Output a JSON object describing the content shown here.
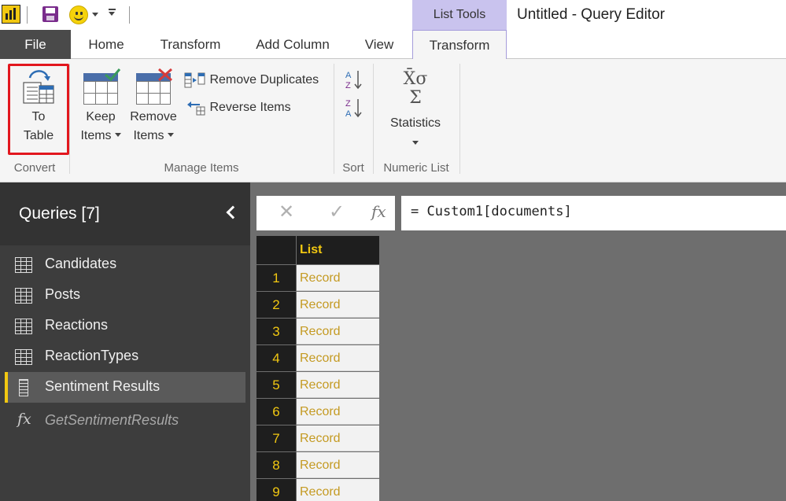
{
  "window": {
    "title": "Untitled - Query Editor",
    "context_tab_group": "List Tools"
  },
  "tabs": [
    {
      "label": "File"
    },
    {
      "label": "Home"
    },
    {
      "label": "Transform"
    },
    {
      "label": "Add Column"
    },
    {
      "label": "View"
    },
    {
      "label": "Transform",
      "active": true
    }
  ],
  "ribbon": {
    "convert": {
      "group_label": "Convert",
      "to_table_line1": "To",
      "to_table_line2": "Table"
    },
    "manage_items": {
      "group_label": "Manage Items",
      "keep_line1": "Keep",
      "keep_line2": "Items",
      "remove_line1": "Remove",
      "remove_line2": "Items",
      "remove_duplicates": "Remove Duplicates",
      "reverse_items": "Reverse Items"
    },
    "sort": {
      "group_label": "Sort",
      "ascending_icon": "sort-ascending-icon",
      "descending_icon": "sort-descending-icon"
    },
    "numeric_list": {
      "group_label": "Numeric List",
      "statistics": "Statistics"
    }
  },
  "sidebar": {
    "title": "Queries [7]",
    "items": [
      {
        "label": "Candidates",
        "icon": "table-icon"
      },
      {
        "label": "Posts",
        "icon": "table-icon"
      },
      {
        "label": "Reactions",
        "icon": "table-icon"
      },
      {
        "label": "ReactionTypes",
        "icon": "table-icon"
      },
      {
        "label": "Sentiment Results",
        "icon": "list-icon",
        "selected": true
      },
      {
        "label": "GetSentimentResults",
        "icon": "fx-icon"
      }
    ]
  },
  "formula_bar": {
    "fx": "fx",
    "formula": "= Custom1[documents]"
  },
  "grid": {
    "column_header": "List",
    "rows": [
      {
        "num": "1",
        "value": "Record"
      },
      {
        "num": "2",
        "value": "Record"
      },
      {
        "num": "3",
        "value": "Record"
      },
      {
        "num": "4",
        "value": "Record"
      },
      {
        "num": "5",
        "value": "Record"
      },
      {
        "num": "6",
        "value": "Record"
      },
      {
        "num": "7",
        "value": "Record"
      },
      {
        "num": "8",
        "value": "Record"
      },
      {
        "num": "9",
        "value": "Record"
      }
    ]
  },
  "colors": {
    "accent_yellow": "#f2c811",
    "context_tab": "#c9c3ee",
    "highlight_red": "#e2171e",
    "record_text": "#c49a22"
  }
}
